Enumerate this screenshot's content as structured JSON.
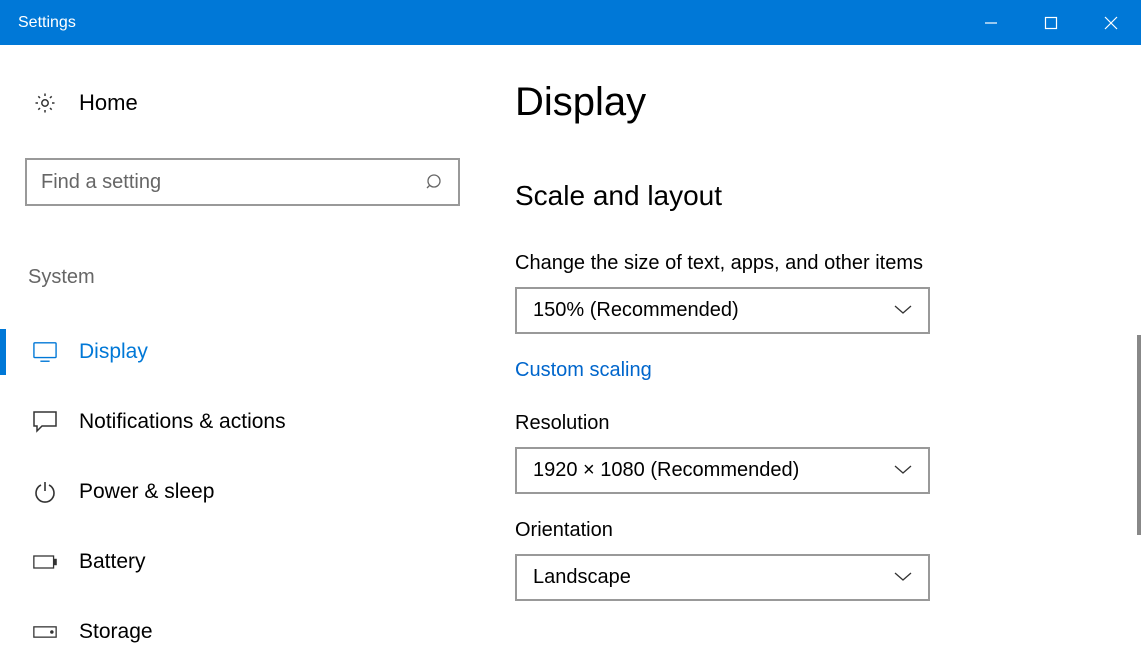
{
  "titlebar": {
    "title": "Settings"
  },
  "sidebar": {
    "home_label": "Home",
    "search_placeholder": "Find a setting",
    "category_label": "System",
    "items": [
      {
        "label": "Display",
        "icon": "monitor",
        "active": true
      },
      {
        "label": "Notifications & actions",
        "icon": "comment",
        "active": false
      },
      {
        "label": "Power & sleep",
        "icon": "power",
        "active": false
      },
      {
        "label": "Battery",
        "icon": "battery",
        "active": false
      },
      {
        "label": "Storage",
        "icon": "storage",
        "active": false
      }
    ]
  },
  "main": {
    "page_title": "Display",
    "section_title": "Scale and layout",
    "scale": {
      "label": "Change the size of text, apps, and other items",
      "value": "150% (Recommended)"
    },
    "custom_scaling_link": "Custom scaling",
    "resolution": {
      "label": "Resolution",
      "value": "1920 × 1080 (Recommended)"
    },
    "orientation": {
      "label": "Orientation",
      "value": "Landscape"
    }
  }
}
